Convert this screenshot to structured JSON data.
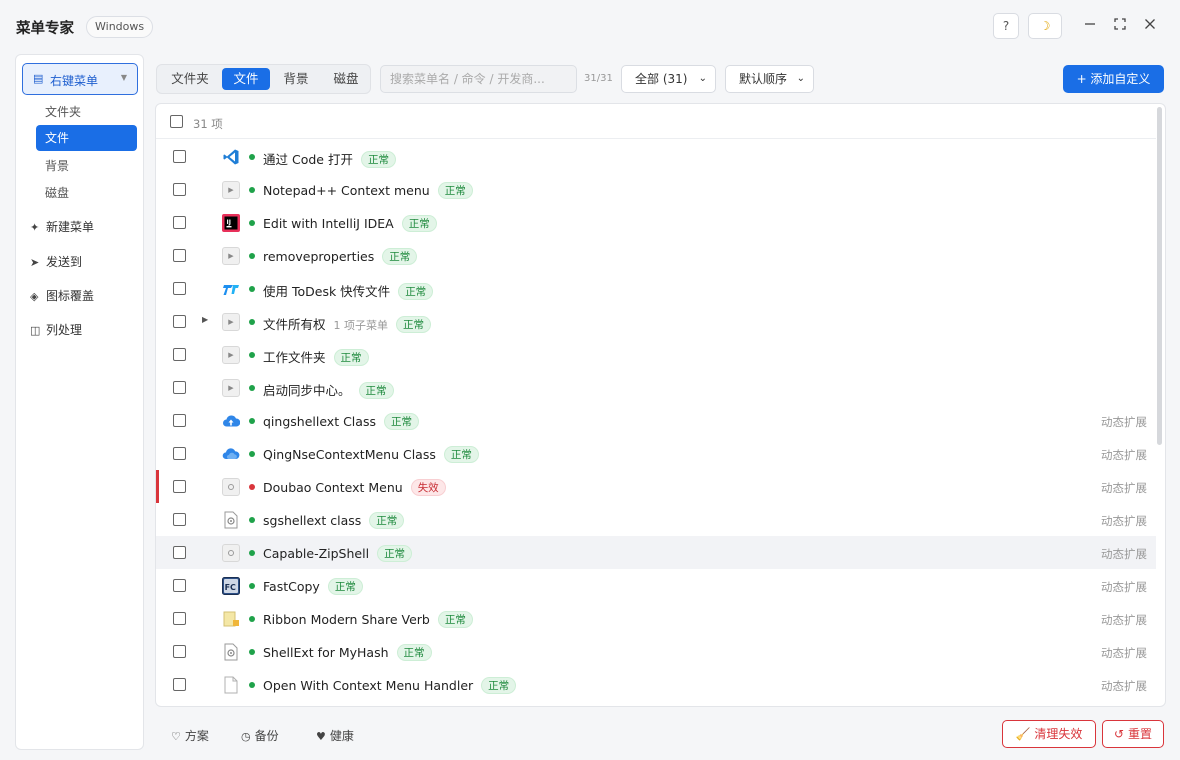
{
  "app": {
    "title": "菜单专家",
    "os_badge": "Windows"
  },
  "titlebar": {
    "help": "?",
    "theme_icon": "☽"
  },
  "sidebar": {
    "menu_select": "右键菜单",
    "subitems": [
      "文件夹",
      "文件",
      "背景",
      "磁盘"
    ],
    "active_subitem": "文件",
    "nav": [
      {
        "icon": "✦",
        "label": "新建菜单"
      },
      {
        "icon": "➤",
        "label": "发送到"
      },
      {
        "icon": "◈",
        "label": "图标覆盖"
      },
      {
        "icon": "◫",
        "label": "列处理"
      }
    ]
  },
  "toolbar": {
    "tabs": [
      "文件夹",
      "文件",
      "背景",
      "磁盘"
    ],
    "active_tab": "文件",
    "search_placeholder": "搜索菜单名 / 命令 / 开发商...",
    "count": "31/31",
    "filter": "全部 (31)",
    "sort": "默认顺序",
    "add_button": "+ 添加自定义"
  },
  "list": {
    "header_count": "31 项",
    "items": [
      {
        "name": "通过 Code 打开",
        "status": "正常",
        "icon": "vscode-icon",
        "dot": "#1fa24a",
        "ext": ""
      },
      {
        "name": "Notepad++ Context menu",
        "status": "正常",
        "icon": "placeholder-icon",
        "dot": "#1fa24a",
        "ext": ""
      },
      {
        "name": "Edit with IntelliJ IDEA",
        "status": "正常",
        "icon": "intellij-icon",
        "dot": "#1fa24a",
        "ext": ""
      },
      {
        "name": "removeproperties",
        "status": "正常",
        "icon": "placeholder-icon",
        "dot": "#1fa24a",
        "ext": ""
      },
      {
        "name": "使用 ToDesk 快传文件",
        "status": "正常",
        "icon": "todesk-icon",
        "dot": "#1fa24a",
        "ext": ""
      },
      {
        "name": "文件所有权",
        "status": "正常",
        "icon": "placeholder-icon",
        "dot": "#1fa24a",
        "ext": "",
        "submenu": "1 项子菜单"
      },
      {
        "name": "工作文件夹",
        "status": "正常",
        "icon": "placeholder-icon",
        "dot": "#1fa24a",
        "ext": ""
      },
      {
        "name": "启动同步中心。",
        "status": "正常",
        "icon": "placeholder-icon",
        "dot": "#1fa24a",
        "ext": ""
      },
      {
        "name": "qingshellext Class",
        "status": "正常",
        "icon": "cloud-upload-icon",
        "dot": "#1fa24a",
        "ext": "动态扩展"
      },
      {
        "name": "QingNseContextMenu Class",
        "status": "正常",
        "icon": "cloud-icon",
        "dot": "#1fa24a",
        "ext": "动态扩展"
      },
      {
        "name": "Doubao Context Menu",
        "status": "失效",
        "icon": "gear-placeholder-icon",
        "dot": "#d9353b",
        "ext": "动态扩展"
      },
      {
        "name": "sgshellext class",
        "status": "正常",
        "icon": "file-gear-icon",
        "dot": "#1fa24a",
        "ext": "动态扩展"
      },
      {
        "name": "Capable-ZipShell",
        "status": "正常",
        "icon": "gear-placeholder-icon",
        "dot": "#1fa24a",
        "ext": "动态扩展"
      },
      {
        "name": "FastCopy",
        "status": "正常",
        "icon": "fastcopy-icon",
        "dot": "#1fa24a",
        "ext": "动态扩展"
      },
      {
        "name": "Ribbon Modern Share Verb",
        "status": "正常",
        "icon": "share-icon",
        "dot": "#1fa24a",
        "ext": "动态扩展"
      },
      {
        "name": "ShellExt for MyHash",
        "status": "正常",
        "icon": "file-gear-icon",
        "dot": "#1fa24a",
        "ext": "动态扩展"
      },
      {
        "name": "Open With Context Menu Handler",
        "status": "正常",
        "icon": "blank-file-icon",
        "dot": "#1fa24a",
        "ext": "动态扩展"
      }
    ]
  },
  "footer": {
    "scheme": "方案",
    "backup": "备份",
    "health": "健康",
    "clean_button": "清理失效",
    "reset_button": "重置"
  }
}
